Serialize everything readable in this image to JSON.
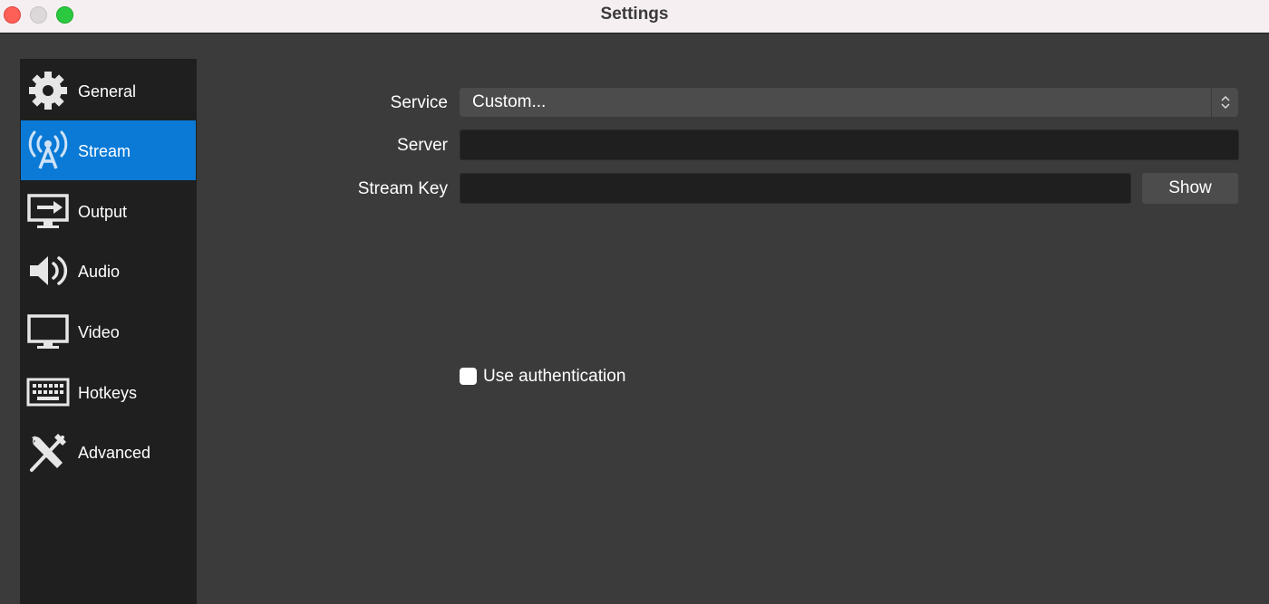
{
  "window": {
    "title": "Settings"
  },
  "sidebar": {
    "items": [
      {
        "label": "General",
        "icon": "gear-icon"
      },
      {
        "label": "Stream",
        "icon": "broadcast-tower-icon",
        "active": true
      },
      {
        "label": "Output",
        "icon": "monitor-arrow-icon"
      },
      {
        "label": "Audio",
        "icon": "speaker-icon"
      },
      {
        "label": "Video",
        "icon": "monitor-icon"
      },
      {
        "label": "Hotkeys",
        "icon": "keyboard-icon"
      },
      {
        "label": "Advanced",
        "icon": "tools-icon"
      }
    ]
  },
  "stream": {
    "service_label": "Service",
    "service_value": "Custom...",
    "server_label": "Server",
    "server_value": "",
    "stream_key_label": "Stream Key",
    "stream_key_value": "",
    "show_button": "Show",
    "use_auth_label": "Use authentication",
    "use_auth_checked": false
  },
  "colors": {
    "accent": "#0a7ad6",
    "background": "#3b3b3b",
    "sidebar": "#1f1f1f",
    "field": "#1f1f1f",
    "titlebar": "#f6eff1"
  }
}
